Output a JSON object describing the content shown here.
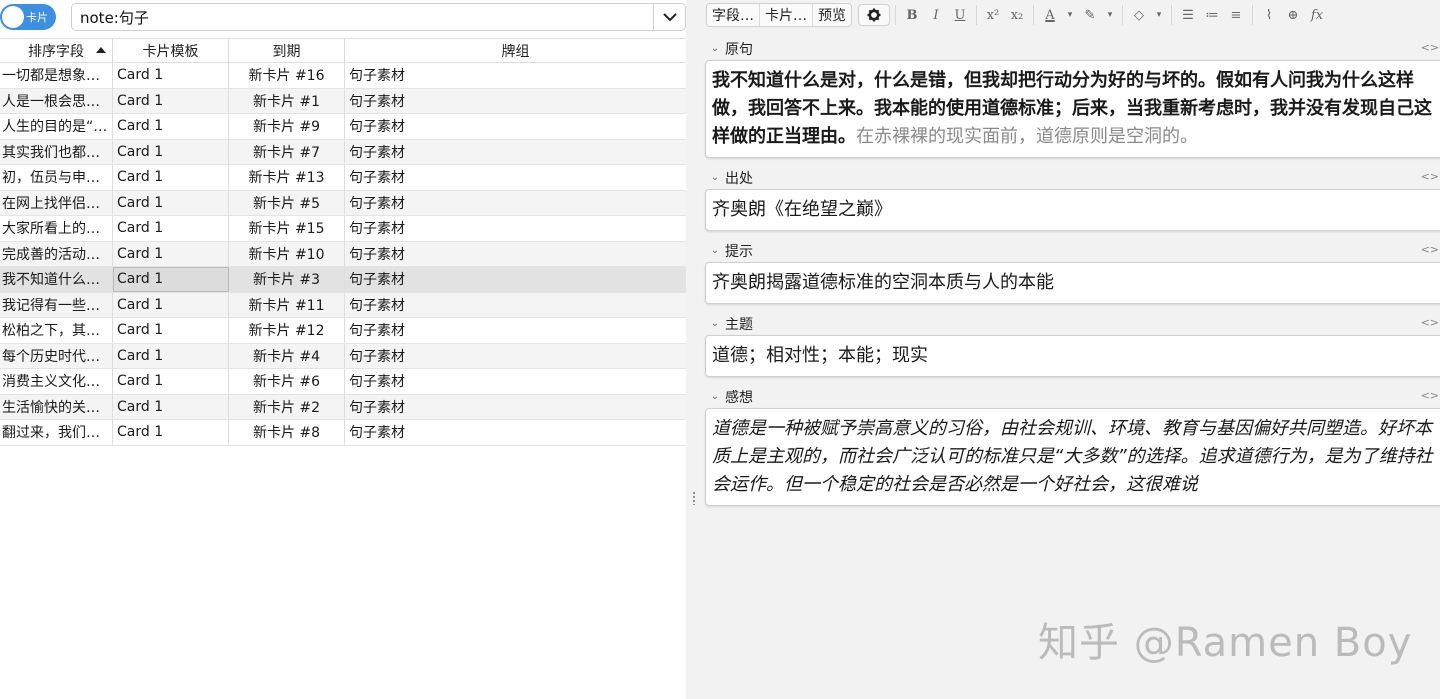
{
  "topbar": {
    "toggle_label": "卡片",
    "search_value": "note:句子"
  },
  "table": {
    "headers": [
      "排序字段",
      "卡片模板",
      "到期",
      "牌组"
    ],
    "rows": [
      {
        "sort": "一切都是想象…",
        "template": "Card 1",
        "due": "新卡片 #16",
        "deck": "句子素材"
      },
      {
        "sort": "人是一根会思…",
        "template": "Card 1",
        "due": "新卡片 #1",
        "deck": "句子素材"
      },
      {
        "sort": "人生的目的是“…",
        "template": "Card 1",
        "due": "新卡片 #9",
        "deck": "句子素材"
      },
      {
        "sort": "其实我们也都…",
        "template": "Card 1",
        "due": "新卡片 #7",
        "deck": "句子素材"
      },
      {
        "sort": "初，伍员与申…",
        "template": "Card 1",
        "due": "新卡片 #13",
        "deck": "句子素材"
      },
      {
        "sort": "在网上找伴侣…",
        "template": "Card 1",
        "due": "新卡片 #5",
        "deck": "句子素材"
      },
      {
        "sort": "大家所看上的…",
        "template": "Card 1",
        "due": "新卡片 #15",
        "deck": "句子素材"
      },
      {
        "sort": "完成善的活动…",
        "template": "Card 1",
        "due": "新卡片 #10",
        "deck": "句子素材"
      },
      {
        "sort": "我不知道什么…",
        "template": "Card 1",
        "due": "新卡片 #3",
        "deck": "句子素材"
      },
      {
        "sort": "我记得有一些…",
        "template": "Card 1",
        "due": "新卡片 #11",
        "deck": "句子素材"
      },
      {
        "sort": "松柏之下，其…",
        "template": "Card 1",
        "due": "新卡片 #12",
        "deck": "句子素材"
      },
      {
        "sort": "每个历史时代…",
        "template": "Card 1",
        "due": "新卡片 #4",
        "deck": "句子素材"
      },
      {
        "sort": "消费主义文化…",
        "template": "Card 1",
        "due": "新卡片 #6",
        "deck": "句子素材"
      },
      {
        "sort": "生活愉快的关…",
        "template": "Card 1",
        "due": "新卡片 #2",
        "deck": "句子素材"
      },
      {
        "sort": "翻过来，我们…",
        "template": "Card 1",
        "due": "新卡片 #8",
        "deck": "句子素材"
      }
    ]
  },
  "editor_toolbar": {
    "fields_btn": "字段…",
    "cards_btn": "卡片…",
    "preview_btn": "预览"
  },
  "fields": [
    {
      "label": "原句",
      "bold_text": "我不知道什么是对，什么是错，但我却把行动分为好的与坏的。假如有人问我为什么这样做，我回答不上来。我本能的使用道德标准；后来，当我重新考虑时，我并没有发现自己这样做的正当理由。",
      "muted_text": "在赤裸裸的现实面前，道德原则是空洞的。"
    },
    {
      "label": "出处",
      "text": "齐奥朗《在绝望之巅》"
    },
    {
      "label": "提示",
      "text": "齐奥朗揭露道德标准的空洞本质与人的本能"
    },
    {
      "label": "主题",
      "text": "道德；相对性；本能；现实"
    },
    {
      "label": "感想",
      "text": "道德是一种被赋予崇高意义的习俗，由社会规训、环境、教育与基因偏好共同塑造。好坏本质上是主观的，而社会广泛认可的标准只是“大多数”的选择。追求道德行为，是为了维持社会运作。但一个稳定的社会是否必然是一个好社会，这很难说"
    }
  ],
  "code_toggle": "<>",
  "watermark": "知乎 @Ramen Boy",
  "colors": {
    "toggle": "#3d8fe0",
    "selected_row": "#e2e2e2"
  }
}
